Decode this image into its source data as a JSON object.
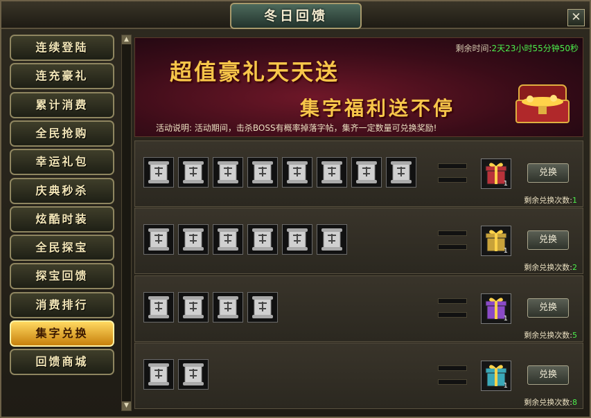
{
  "window": {
    "title": "冬日回馈",
    "close_label": "✕"
  },
  "sidebar": {
    "items": [
      {
        "label": "连续登陆"
      },
      {
        "label": "连充豪礼"
      },
      {
        "label": "累计消费"
      },
      {
        "label": "全民抢购"
      },
      {
        "label": "幸运礼包"
      },
      {
        "label": "庆典秒杀"
      },
      {
        "label": "炫酷时装"
      },
      {
        "label": "全民探宝"
      },
      {
        "label": "探宝回馈"
      },
      {
        "label": "消费排行"
      },
      {
        "label": "集字兑换",
        "active": true
      },
      {
        "label": "回馈商城"
      }
    ]
  },
  "banner": {
    "title1": "超值豪礼天天送",
    "title2": "集字福利送不停",
    "timer_label": "剩余时间:",
    "timer_value": "2天23小时55分钟50秒",
    "desc_label": "活动说明:",
    "desc_text": "活动期间，击杀BOSS有概率掉落字帖，集齐一定数量可兑换奖励!"
  },
  "rows": [
    {
      "scrolls": 8,
      "gift_color": "#b8323a",
      "gift_count": "1",
      "button": "兑换",
      "remain_label": "剩余兑换次数:",
      "remain_value": "1"
    },
    {
      "scrolls": 6,
      "gift_color": "#c8a23a",
      "gift_count": "1",
      "button": "兑换",
      "remain_label": "剩余兑换次数:",
      "remain_value": "2"
    },
    {
      "scrolls": 4,
      "gift_color": "#8a4ac8",
      "gift_count": "1",
      "button": "兑换",
      "remain_label": "剩余兑换次数:",
      "remain_value": "5"
    },
    {
      "scrolls": 2,
      "gift_color": "#3aa8b8",
      "gift_count": "1",
      "button": "兑换",
      "remain_label": "剩余兑换次数:",
      "remain_value": "8"
    }
  ],
  "icons": {
    "scroll": "scroll-icon",
    "gift": "gift-box-icon",
    "chest": "treasure-chest-icon",
    "scroll_up": "arrow-up-icon",
    "scroll_down": "arrow-down-icon"
  },
  "colors": {
    "accent_gold": "#f7c64a",
    "timer_green": "#4cf04c",
    "active_tab": "#e8a820"
  }
}
